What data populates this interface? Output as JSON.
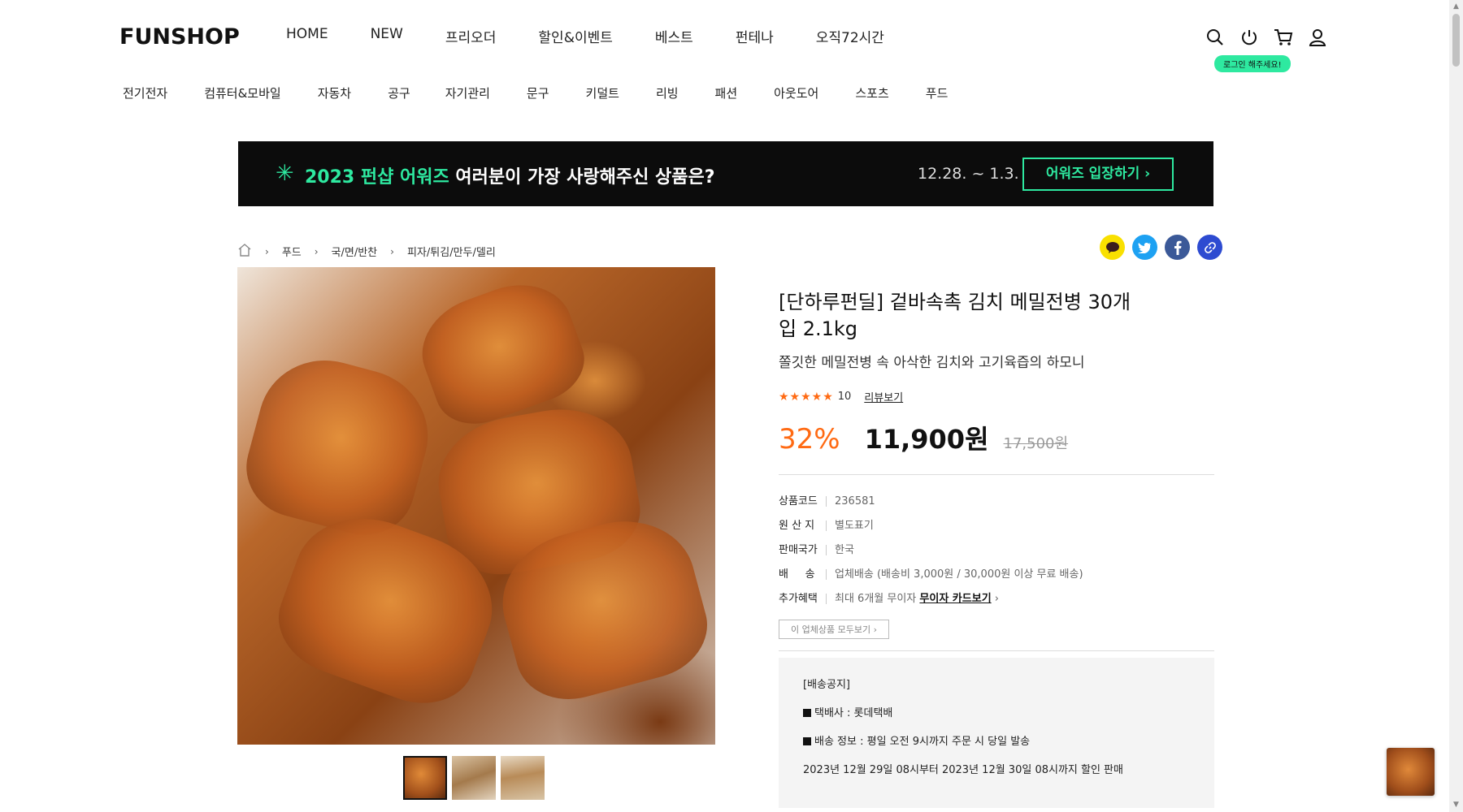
{
  "header": {
    "logo": "FUNSHOP",
    "nav": [
      "HOME",
      "NEW",
      "프리오더",
      "할인&이벤트",
      "베스트",
      "펀테나",
      "오직72시간"
    ],
    "login_badge": "로그인 해주세요!",
    "categories": [
      "전기전자",
      "컴퓨터&모바일",
      "자동차",
      "공구",
      "자기관리",
      "문구",
      "키덜트",
      "리빙",
      "패션",
      "아웃도어",
      "스포츠",
      "푸드"
    ]
  },
  "banner": {
    "highlight": "2023 펀샵 어워즈",
    "text": "여러분이 가장 사랑해주신 상품은?",
    "date": "12.28. ~ 1.3.",
    "button": "어워즈 입장하기 ›"
  },
  "breadcrumb": [
    "푸드",
    "국/면/반찬",
    "피자/튀김/만두/델리"
  ],
  "product": {
    "title": "[단하루펀딜] 겉바속촉 김치 메밀전병 30개입 2.1kg",
    "subtitle": "쫄깃한 메밀전병 속 아삭한 김치와 고기육즙의 하모니",
    "rating": 5,
    "review_count": "10",
    "review_link": "리뷰보기",
    "discount": "32%",
    "price": "11,900원",
    "original_price": "17,500원",
    "specs": [
      {
        "label": "상품코드",
        "value": "236581"
      },
      {
        "label": "원 산 지",
        "value": "별도표기"
      },
      {
        "label": "판매국가",
        "value": "한국"
      },
      {
        "label": "배     송",
        "value": "업체배송 (배송비 3,000원 / 30,000원 이상 무료 배송)"
      },
      {
        "label": "추가혜택",
        "value": "최대 6개월 무이자",
        "link": "무이자 카드보기"
      }
    ],
    "vendor_button": "이 업체상품 모두보기 ›"
  },
  "notice": {
    "title": "[배송공지]",
    "carrier": "택배사 : 롯데택배",
    "shipping": "배송 정보 : 평일 오전 9시까지 주문 시 당일 발송",
    "period": "2023년 12월 29일 08시부터 2023년 12월 30일 08시까지 할인 판매"
  },
  "colors": {
    "accent_green": "#2ee9a0",
    "discount_orange": "#ff6a13",
    "kakao": "#f9e000",
    "twitter": "#1da1f2",
    "facebook": "#3b5998",
    "link": "#2d4bd1"
  }
}
